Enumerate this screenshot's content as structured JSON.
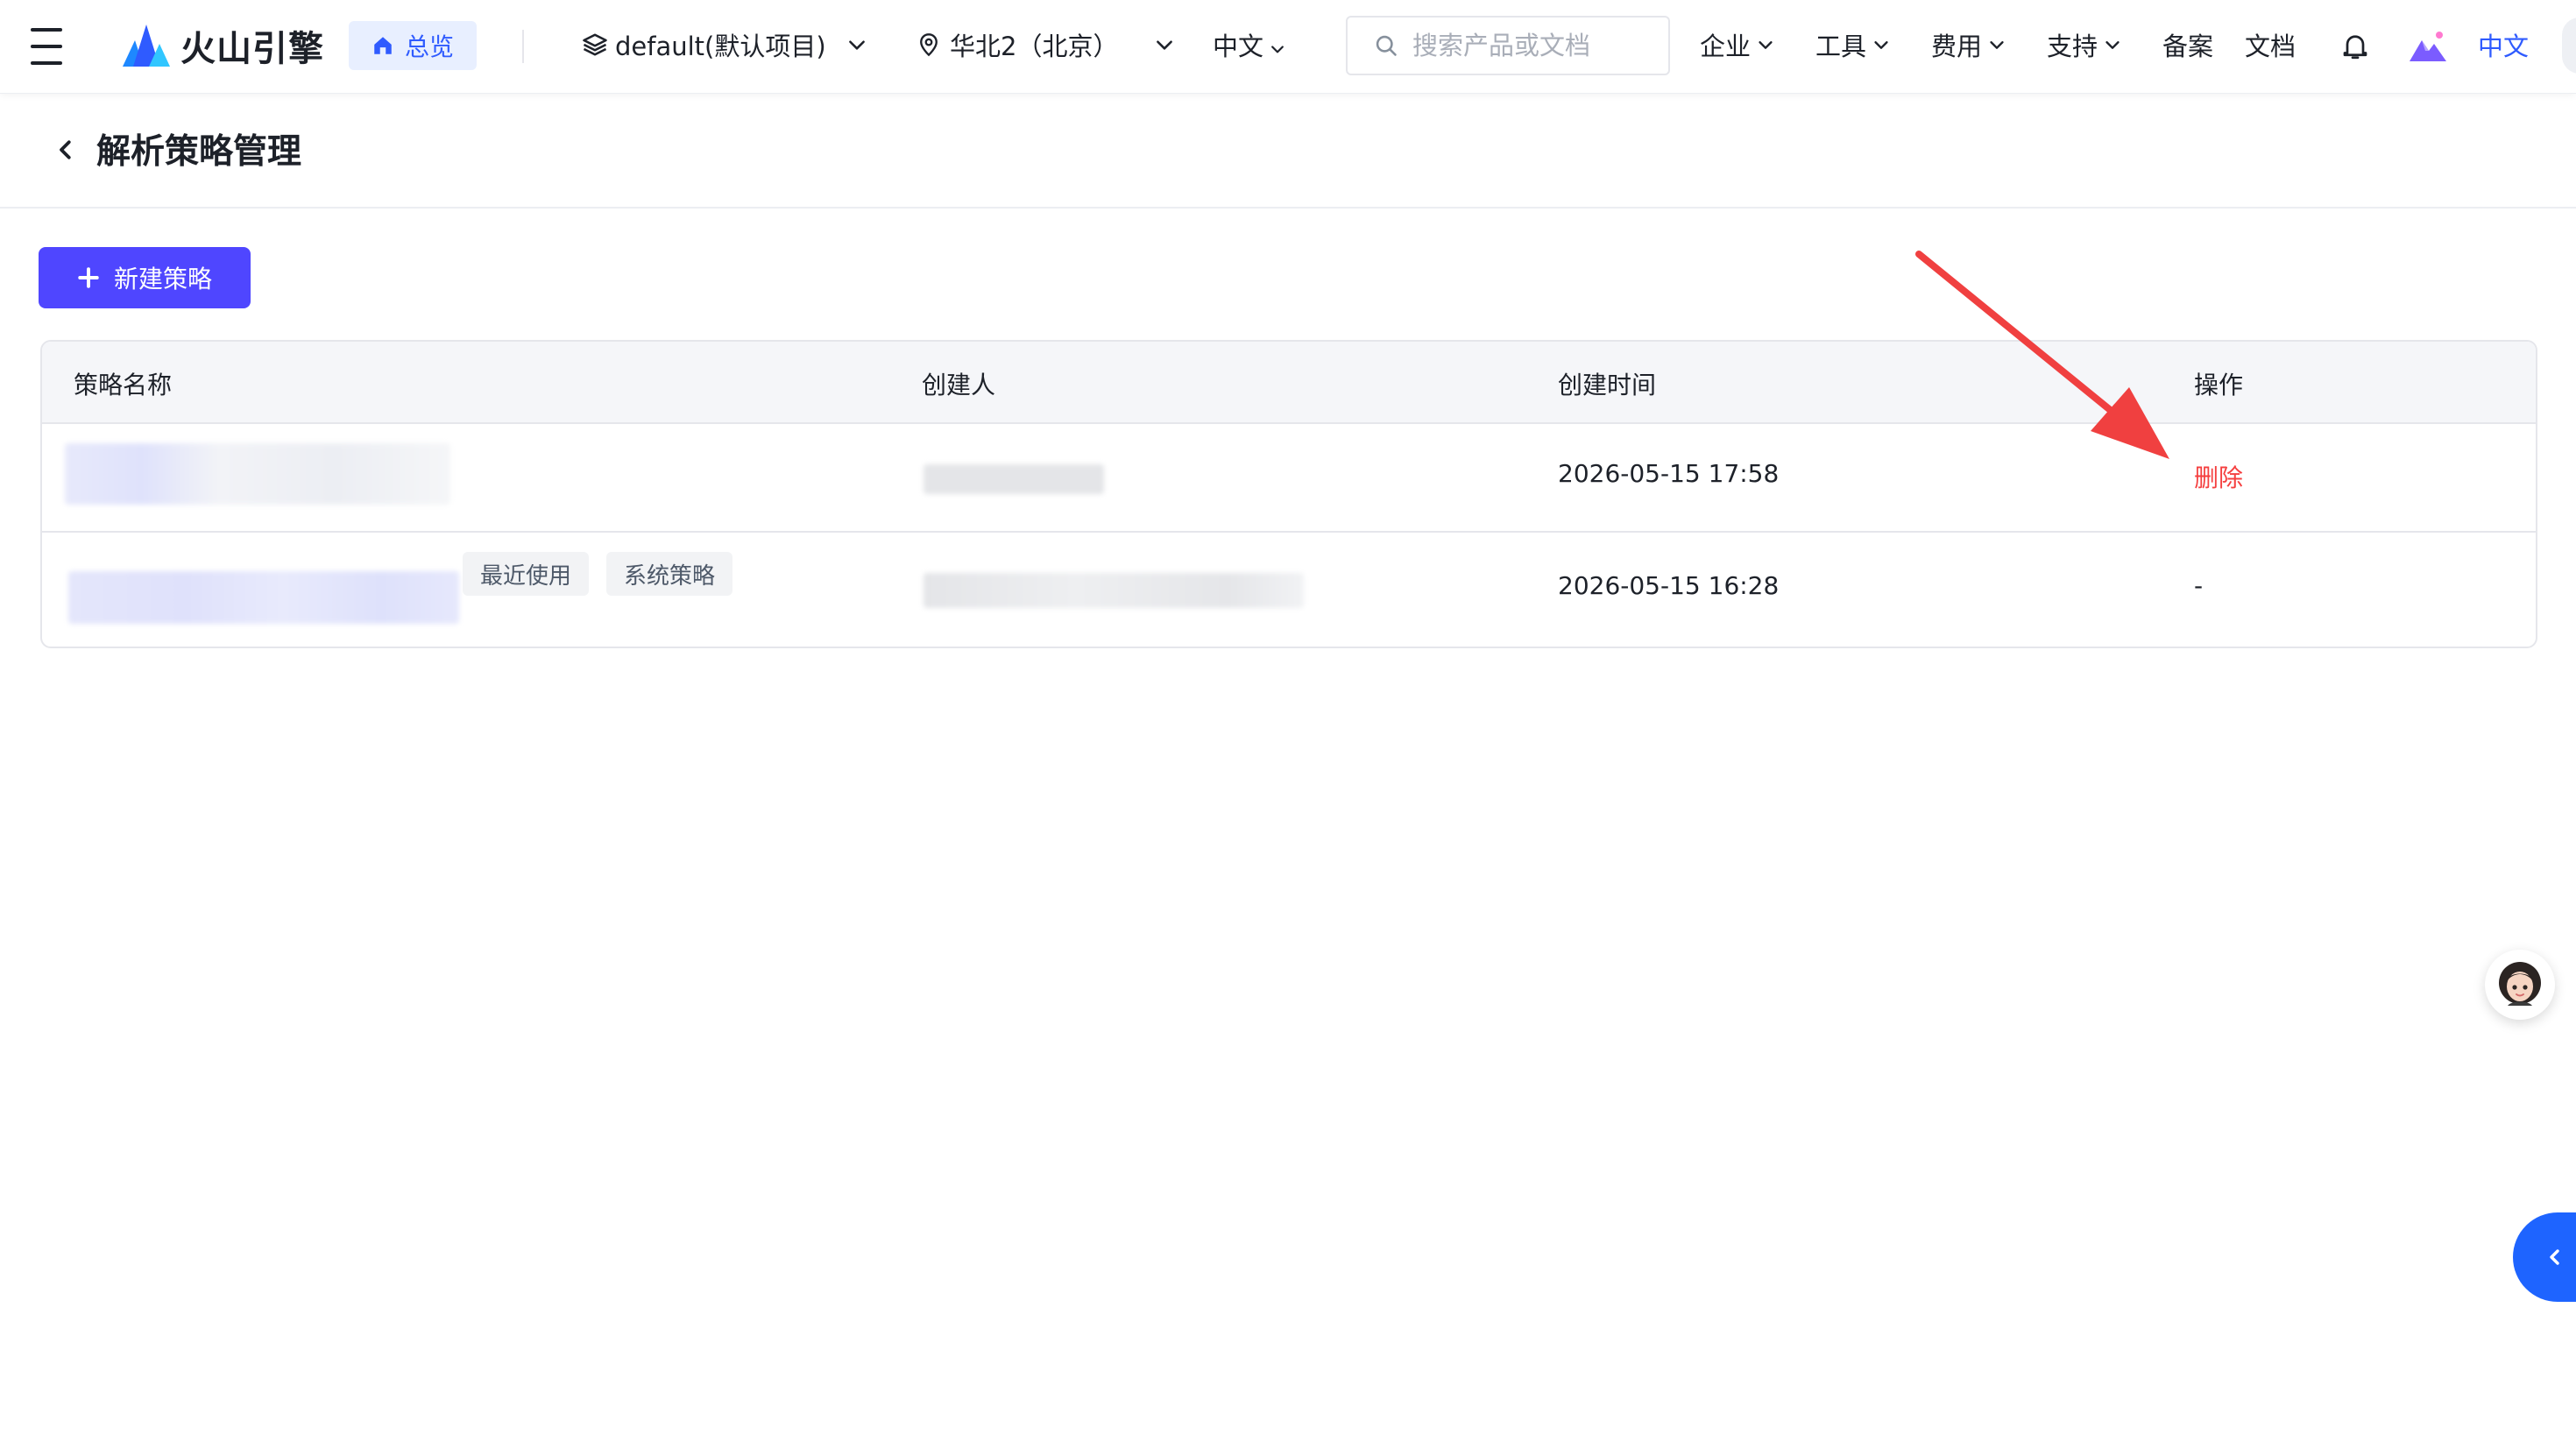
{
  "topbar": {
    "brand": "火山引擎",
    "home_label": "总览",
    "project": "default(默认项目)",
    "region": "华北2（北京）",
    "language_select": "中文",
    "search_placeholder": "搜索产品或文档",
    "nav_items": [
      "企业",
      "工具",
      "费用",
      "支持",
      "备案",
      "文档"
    ],
    "language_link": "中文"
  },
  "page": {
    "title": "解析策略管理",
    "new_button": "新建策略"
  },
  "table": {
    "columns": [
      "策略名称",
      "创建人",
      "创建时间",
      "操作"
    ],
    "rows": [
      {
        "name": "",
        "tags": [],
        "creator": "",
        "created_at": "2026-05-15 17:58",
        "action": "删除"
      },
      {
        "name": "",
        "tags": [
          "最近使用",
          "系统策略"
        ],
        "creator": "",
        "created_at": "2026-05-15 16:28",
        "action": "-"
      }
    ]
  },
  "colors": {
    "primary": "#4f46ff",
    "brand_blue": "#2f5bff",
    "danger": "#f53f3f",
    "annotation_arrow": "#f04040"
  },
  "icons": {
    "menu": "hamburger-icon",
    "logo": "volcano-logo-icon",
    "home": "home-icon",
    "project": "layers-icon",
    "region": "location-pin-icon",
    "search": "search-icon",
    "notification": "bell-icon",
    "assistant": "mountain-avatar-icon",
    "back": "chevron-left-icon",
    "add": "plus-icon",
    "support": "support-avatar-icon",
    "collapse": "chevron-left-icon"
  }
}
